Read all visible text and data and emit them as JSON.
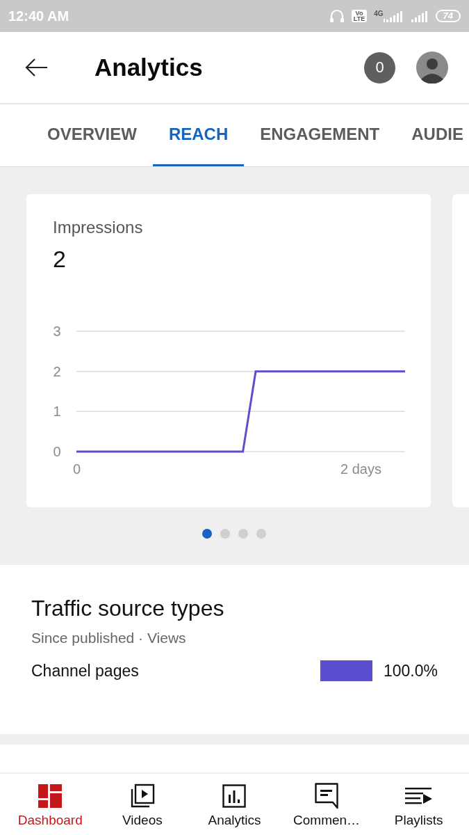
{
  "status_bar": {
    "time": "12:40 AM",
    "volte": [
      "Vo",
      "LTE"
    ],
    "network": "4G",
    "battery": "74"
  },
  "header": {
    "title": "Analytics",
    "notification_count": "0"
  },
  "tabs": [
    {
      "label": "OVERVIEW",
      "selected": false
    },
    {
      "label": "REACH",
      "selected": true
    },
    {
      "label": "ENGAGEMENT",
      "selected": false
    },
    {
      "label": "AUDIE",
      "selected": false
    }
  ],
  "metric_card": {
    "title": "Impressions",
    "value": "2",
    "chart_data": {
      "type": "line",
      "x": [
        0,
        1.17,
        1.26,
        2.31
      ],
      "series": [
        {
          "color": "#5b4fcf",
          "values": [
            0,
            0,
            2,
            2
          ]
        }
      ],
      "xlim": [
        0,
        2.31
      ],
      "ylim": [
        0,
        3
      ],
      "xticks": [
        {
          "value": 0,
          "label": "0"
        },
        {
          "value": 2,
          "label": "2 days"
        }
      ],
      "yticks": [
        0,
        1,
        2,
        3
      ]
    }
  },
  "carousel_dots": [
    {
      "selected": true
    },
    {
      "selected": false
    },
    {
      "selected": false
    },
    {
      "selected": false
    }
  ],
  "traffic": {
    "title": "Traffic source types",
    "subtitle": "Since published · Views",
    "rows": [
      {
        "label": "Channel pages",
        "value": "100.0%",
        "color": "#5b4fcf"
      }
    ]
  },
  "bottom_nav": [
    {
      "kind": "dashboard",
      "label": "Dashboard",
      "selected": true
    },
    {
      "kind": "videos",
      "label": "Videos",
      "selected": false
    },
    {
      "kind": "analytics",
      "label": "Analytics",
      "selected": false
    },
    {
      "kind": "comments",
      "label": "Commen…",
      "selected": false
    },
    {
      "kind": "playlists",
      "label": "Playlists",
      "selected": false
    }
  ]
}
